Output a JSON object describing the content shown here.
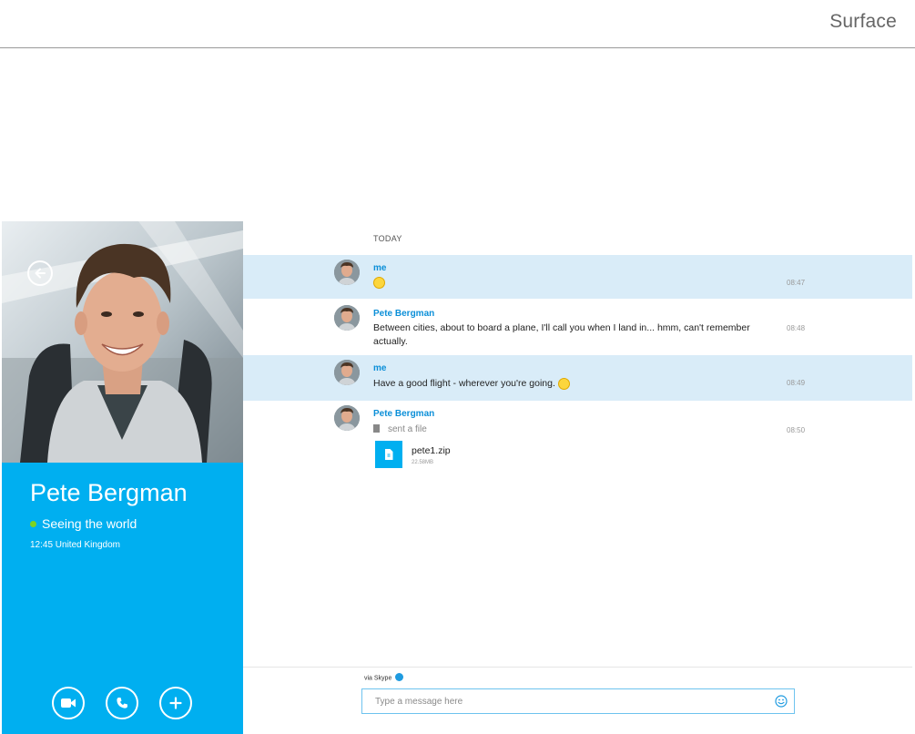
{
  "header": {
    "brand": "Surface"
  },
  "contact": {
    "name": "Pete Bergman",
    "mood": "Seeing the world",
    "local_time": "12:45 United Kingdom",
    "presence_color": "#7ed321"
  },
  "actions": [
    {
      "name": "video-call",
      "icon": "video-camera-icon"
    },
    {
      "name": "voice-call",
      "icon": "phone-icon"
    },
    {
      "name": "add",
      "icon": "plus-icon"
    }
  ],
  "conversation": {
    "day_label": "TODAY",
    "messages": [
      {
        "sender": "me",
        "text": "",
        "emoji": "wink-emoji-icon",
        "time": "08:47"
      },
      {
        "sender": "Pete Bergman",
        "text": "Between cities, about to board a plane, I'll call you when I land in... hmm, can't remember actually.",
        "time": "08:48"
      },
      {
        "sender": "me",
        "text": "Have a good flight - wherever you're going.",
        "emoji": "grin-emoji-icon",
        "time": "08:49"
      },
      {
        "sender": "Pete Bergman",
        "file_action": "sent a file",
        "file_name": "pete1.zip",
        "file_size": "22.58MB",
        "time": "08:50"
      }
    ]
  },
  "composer": {
    "via_label": "via Skype",
    "placeholder": "Type a message here"
  },
  "colors": {
    "accent": "#00aff0",
    "link": "#0b8fd8",
    "highlight_row": "#d9ecf8",
    "composer_border": "#6ec3ef"
  }
}
